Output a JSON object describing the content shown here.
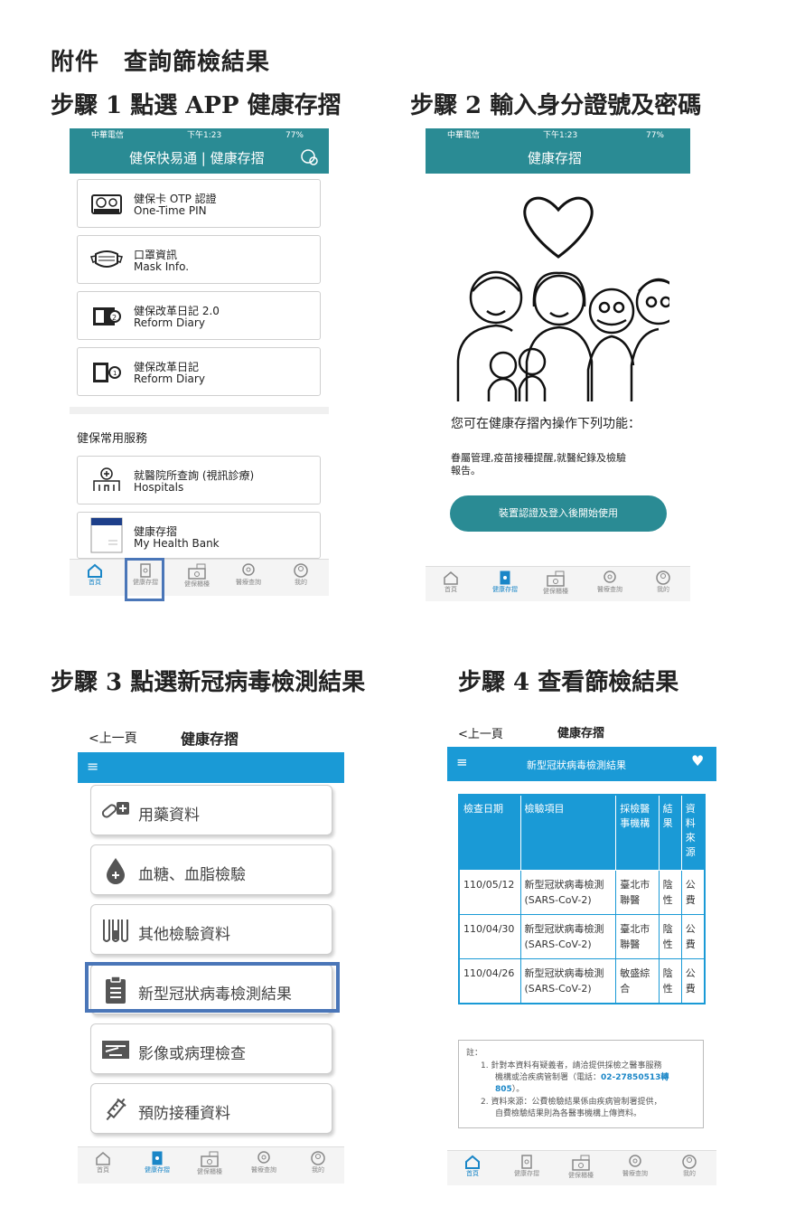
{
  "heading": "附件　查詢篩檢結果",
  "steps": [
    {
      "title": "步驟 1  點選 APP 健康存摺"
    },
    {
      "title": "步驟 2 輸入身分證號及密碼"
    },
    {
      "title": "步驟 3 點選新冠病毒檢測結果"
    },
    {
      "title": "步驟 4  查看篩檢結果"
    }
  ],
  "status": {
    "carrier": "中華電信",
    "time": "下午1:23",
    "battery": "77%"
  },
  "screen1": {
    "title": "健保快易通 | 健康存摺",
    "cards": [
      {
        "line1": "健保卡 OTP 認證",
        "line2": "One-Time PIN",
        "icon": "otp-card-icon"
      },
      {
        "line1": "口罩資訊",
        "line2": "Mask Info.",
        "icon": "mask-icon"
      },
      {
        "line1": "健保改革日記 2.0",
        "line2": "Reform Diary",
        "icon": "diary-icon"
      },
      {
        "line1": "健保改革日記",
        "line2": "Reform Diary",
        "icon": "diary-old-icon"
      }
    ],
    "section": "健保常用服務",
    "services": [
      {
        "line1": "就醫院所查詢 (視訊診療)",
        "line2": "Hospitals",
        "icon": "hospital-icon"
      },
      {
        "line1": "健康存摺",
        "line2": "My Health Bank",
        "icon": "health-bank-icon"
      }
    ]
  },
  "tabs": [
    "首頁",
    "健康存摺",
    "健保櫃檯",
    "醫療查詢",
    "我的"
  ],
  "screen2": {
    "title": "健康存摺",
    "intro": "您可在健康存摺內操作下列功能：",
    "desc_line1": "眷屬管理,疫苗接種提醒,就醫紀錄及檢驗",
    "desc_line2": "報告。",
    "button": "裝置認證及登入後開始使用"
  },
  "screen3": {
    "back": "<上一頁",
    "title": "健康存摺",
    "items": [
      {
        "label": "用藥資料",
        "icon": "medicine-icon"
      },
      {
        "label": "血糖、血脂檢驗",
        "icon": "blood-drop-icon"
      },
      {
        "label": "其他檢驗資料",
        "icon": "test-tubes-icon"
      },
      {
        "label": "新型冠狀病毒檢測結果",
        "icon": "clipboard-icon"
      },
      {
        "label": "影像或病理檢查",
        "icon": "xray-icon"
      },
      {
        "label": "預防接種資料",
        "icon": "syringe-icon"
      }
    ]
  },
  "screen4": {
    "back": "<上一頁",
    "title": "健康存摺",
    "banner": "新型冠狀病毒檢測結果",
    "headers": [
      "檢查日期",
      "檢驗項目",
      "採檢醫事機構",
      "結果",
      "資料來源"
    ],
    "rows": [
      {
        "date": "110/05/12",
        "item": "新型冠狀病毒檢測(SARS-CoV-2)",
        "org": "臺北市聯醫",
        "result": "陰性",
        "source": "公費"
      },
      {
        "date": "110/04/30",
        "item": "新型冠狀病毒檢測(SARS-CoV-2)",
        "org": "臺北市聯醫",
        "result": "陰性",
        "source": "公費"
      },
      {
        "date": "110/04/26",
        "item": "新型冠狀病毒檢測(SARS-CoV-2)",
        "org": "敏盛綜合",
        "result": "陰性",
        "source": "公費"
      }
    ],
    "note_label": "註：",
    "note1_a": "1.  針對本資料有疑義者，請洽提供採檢之醫事服務",
    "note1_b": "機構或洽疾病管制署（電話：",
    "note1_phone": "02-27850513轉",
    "note1_c": "805",
    "note1_d": "）。",
    "note2_a": "2.  資料來源：公費檢驗結果係由疾病管制署提供，",
    "note2_b": "自費檢驗結果則為各醫事機構上傳資料。"
  },
  "colors": {
    "teal": "#2a8b94",
    "blue": "#1a9ad6",
    "highlight": "#4a76b8"
  }
}
